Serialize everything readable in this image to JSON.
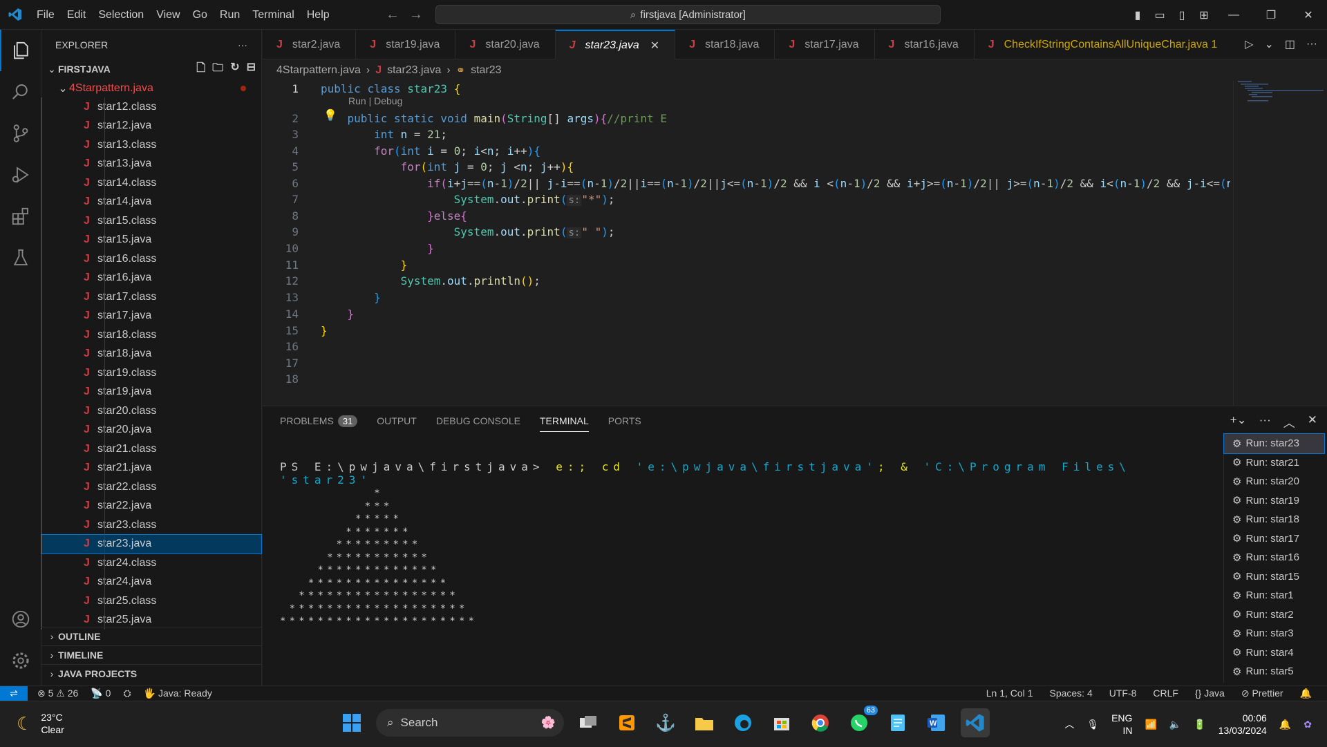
{
  "titlebar": {
    "menu": [
      "File",
      "Edit",
      "Selection",
      "View",
      "Go",
      "Run",
      "Terminal",
      "Help"
    ],
    "command_center": "firstjava [Administrator]"
  },
  "sidebar": {
    "title": "EXPLORER",
    "root": "FIRSTJAVA",
    "subfolder": "4Starpattern.java",
    "files": [
      "star12.class",
      "star12.java",
      "star13.class",
      "star13.java",
      "star14.class",
      "star14.java",
      "star15.class",
      "star15.java",
      "star16.class",
      "star16.java",
      "star17.class",
      "star17.java",
      "star18.class",
      "star18.java",
      "star19.class",
      "star19.java",
      "star20.class",
      "star20.java",
      "star21.class",
      "star21.java",
      "star22.class",
      "star22.java",
      "star23.class",
      "star23.java",
      "star24.class",
      "star24.java",
      "star25.class",
      "star25.java"
    ],
    "selected": "star23.java",
    "sections": [
      "OUTLINE",
      "TIMELINE",
      "JAVA PROJECTS"
    ]
  },
  "tabs": [
    "star2.java",
    "star19.java",
    "star20.java",
    "star23.java",
    "star18.java",
    "star17.java",
    "star16.java",
    "CheckIfStringContainsAllUniqueChar.java 1"
  ],
  "active_tab": "star23.java",
  "breadcrumb": {
    "folder": "4Starpattern.java",
    "file": "star23.java",
    "symbol": "star23"
  },
  "editor": {
    "codelens": "Run | Debug",
    "comment": "//print E",
    "n_value": "21"
  },
  "panel": {
    "tabs": [
      "PROBLEMS",
      "OUTPUT",
      "DEBUG CONSOLE",
      "TERMINAL",
      "PORTS"
    ],
    "problems_count": "31",
    "active": "TERMINAL",
    "prompt": "PS E:\\pwjava\\firstjava>",
    "command_a": "e:; cd",
    "command_b": "'e:\\pwjava\\firstjava'",
    "command_c": "; &",
    "command_d": "'C:\\Program Files\\",
    "command_e": "'star23'",
    "run_items": [
      "Run: star23",
      "Run: star21",
      "Run: star20",
      "Run: star19",
      "Run: star18",
      "Run: star17",
      "Run: star16",
      "Run: star15",
      "Run: star1",
      "Run: star2",
      "Run: star3",
      "Run: star4",
      "Run: star5"
    ]
  },
  "statusbar": {
    "errors": "5",
    "warnings": "26",
    "ports": "0",
    "java": "Java: Ready",
    "position": "Ln 1, Col 1",
    "spaces": "Spaces: 4",
    "encoding": "UTF-8",
    "eol": "CRLF",
    "language": "Java",
    "prettier": "Prettier"
  },
  "taskbar": {
    "temp": "23°C",
    "condition": "Clear",
    "search": "Search",
    "whatsapp_badge": "63",
    "lang": "ENG",
    "region": "IN",
    "time": "00:06",
    "date": "13/03/2024"
  }
}
